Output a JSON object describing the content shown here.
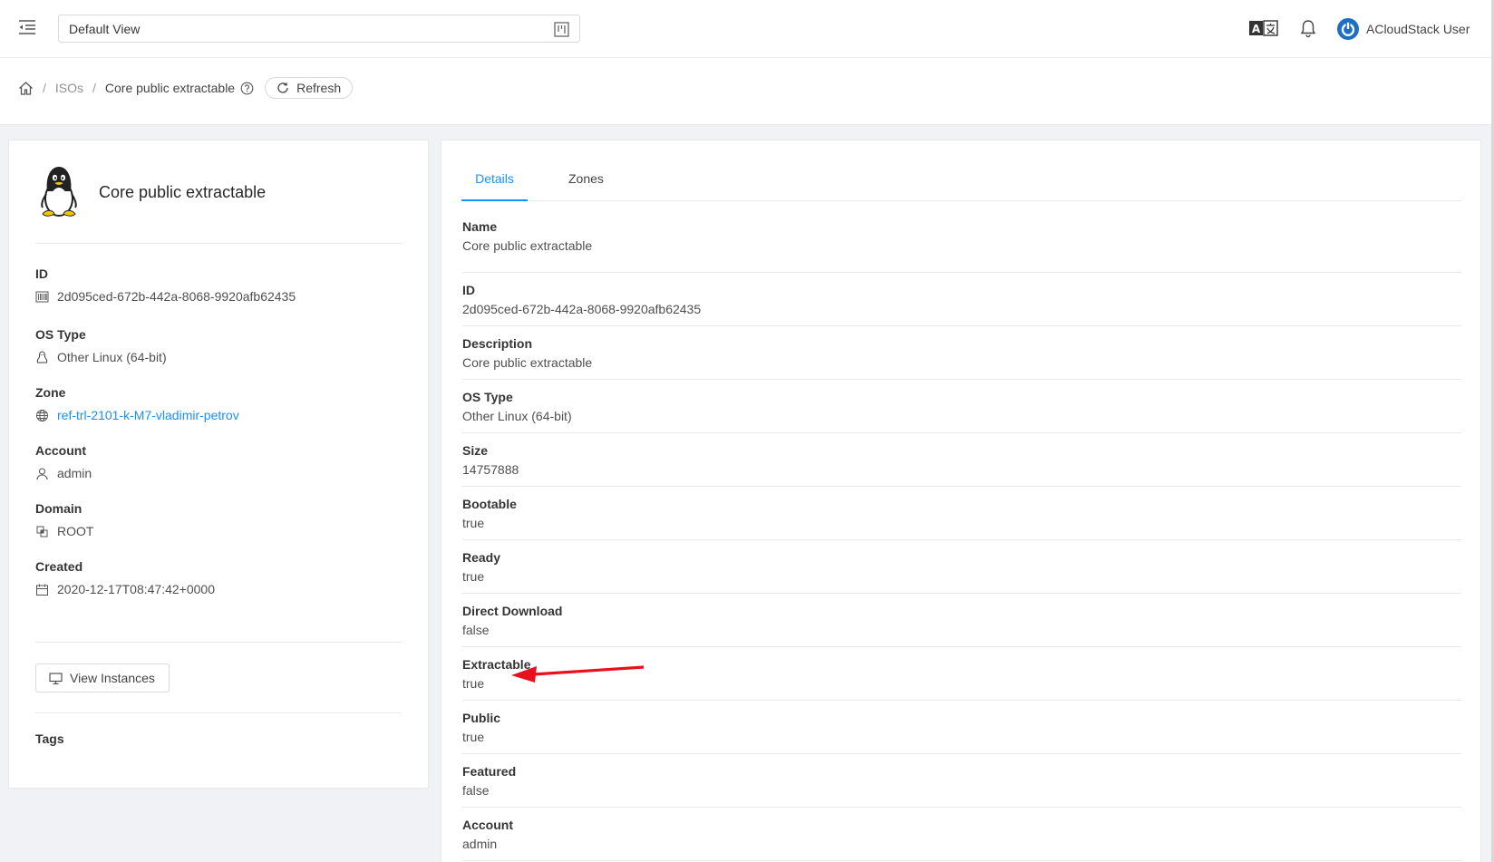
{
  "header": {
    "view_select_value": "Default View",
    "user_name": "ACloudStack User"
  },
  "breadcrumb": {
    "isos_label": "ISOs",
    "current_label": "Core public extractable",
    "refresh_label": "Refresh"
  },
  "summary": {
    "title": "Core public extractable",
    "fields": {
      "id": {
        "label": "ID",
        "value": "2d095ced-672b-442a-8068-9920afb62435"
      },
      "ostype": {
        "label": "OS Type",
        "value": "Other Linux (64-bit)"
      },
      "zone": {
        "label": "Zone",
        "value": "ref-trl-2101-k-M7-vladimir-petrov"
      },
      "account": {
        "label": "Account",
        "value": "admin"
      },
      "domain": {
        "label": "Domain",
        "value": "ROOT"
      },
      "created": {
        "label": "Created",
        "value": "2020-12-17T08:47:42+0000"
      }
    },
    "view_instances_label": "View Instances",
    "tags_label": "Tags"
  },
  "tabs": [
    {
      "label": "Details",
      "active": true
    },
    {
      "label": "Zones",
      "active": false
    }
  ],
  "details": [
    {
      "key": "Name",
      "value": "Core public extractable"
    },
    {
      "key": "ID",
      "value": "2d095ced-672b-442a-8068-9920afb62435"
    },
    {
      "key": "Description",
      "value": "Core public extractable"
    },
    {
      "key": "OS Type",
      "value": "Other Linux (64-bit)"
    },
    {
      "key": "Size",
      "value": "14757888"
    },
    {
      "key": "Bootable",
      "value": "true"
    },
    {
      "key": "Ready",
      "value": "true"
    },
    {
      "key": "Direct Download",
      "value": "false"
    },
    {
      "key": "Extractable",
      "value": "true"
    },
    {
      "key": "Public",
      "value": "true"
    },
    {
      "key": "Featured",
      "value": "false"
    },
    {
      "key": "Account",
      "value": "admin"
    }
  ],
  "colors": {
    "accent": "#1890ff",
    "annotation_arrow": "#e8101c"
  },
  "icons": {
    "menu": "menu-fold-icon",
    "view_select": "project-icon",
    "language": "translate-icon",
    "notifications": "bell-icon",
    "user": "power-avatar-icon",
    "home": "home-icon",
    "help": "question-circle-icon",
    "refresh": "reload-icon",
    "os": "linux-penguin-icon",
    "id": "barcode-icon",
    "zone": "globe-icon",
    "account": "user-icon",
    "domain": "block-icon",
    "created": "calendar-icon",
    "instances": "desktop-icon"
  }
}
